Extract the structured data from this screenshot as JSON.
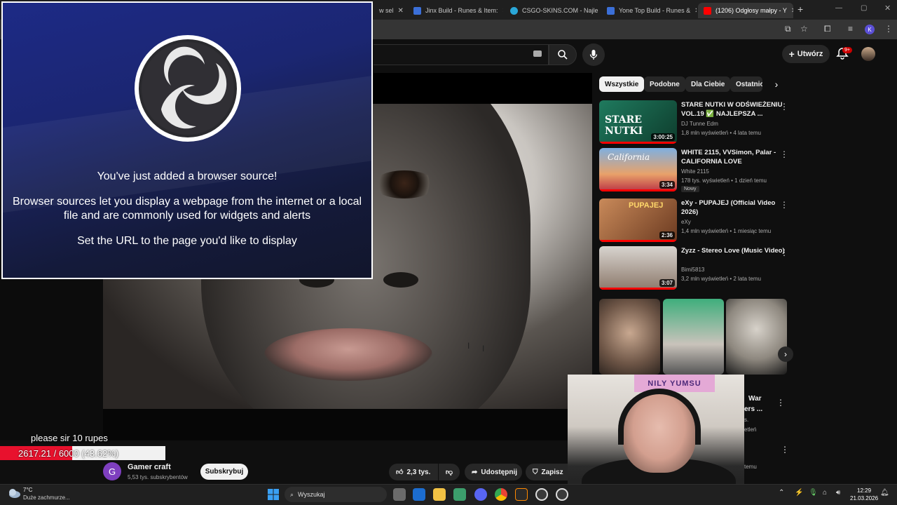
{
  "browser": {
    "tabs": [
      {
        "label": "w sel",
        "active": false
      },
      {
        "label": "Jinx Build - Runes & Item:",
        "active": false
      },
      {
        "label": "CSGO-SKINS.COM - Najle",
        "active": false
      },
      {
        "label": "Yone Top Build - Runes &",
        "active": false
      },
      {
        "label": "(1206) Odgłosy małpy - Y",
        "active": true
      }
    ],
    "profile_letter": "K"
  },
  "youtube": {
    "create_label": "Utwórz",
    "notif_count": "9+",
    "chips": [
      "Wszystkie",
      "Podobne",
      "Dla Ciebie",
      "Ostatnio"
    ],
    "recommendations": [
      {
        "title": "STARE NUTKI W ODŚWIEŻENIU VOL.19 ✅ NAJLEPSZA ...",
        "channel": "DJ Tunne Edm",
        "stats": "1,8 mln wyświetleń • 4 lata temu",
        "duration": "3:00:25",
        "badge": "",
        "thumb_text": "STARE NUTKI"
      },
      {
        "title": "WHITE 2115, VVSimon, Palar - CALIFORNIA LOVE",
        "channel": "White 2115",
        "stats": "178 tys. wyświetleń • 1 dzień temu",
        "duration": "3:34",
        "badge": "Nowy",
        "thumb_text": "California"
      },
      {
        "title": "eXy - PUPAJEJ (Official Video 2026)",
        "channel": "eXy",
        "stats": "1,4 mln wyświetleń • 1 miesiąc temu",
        "duration": "2:36",
        "badge": "",
        "thumb_text": "PUPAJEJ"
      },
      {
        "title": "Zyzz - Stereo Love (Music Video)",
        "channel": "Bimi5813",
        "stats": "3,2 mln wyświetleń • 2 lata temu",
        "duration": "3:07",
        "badge": "",
        "thumb_text": ""
      }
    ],
    "partial_items": {
      "title_fragment_1": "War",
      "title_fragment_2": "ers ...",
      "meta_1": "s.",
      "meta_2": "etleń",
      "meta_3": "temu"
    },
    "channel": {
      "name": "Gamer craft",
      "subs": "5,53 tys. subskrybentów",
      "avatar_letter": "G",
      "subscribe_label": "Subskrybuj"
    },
    "actions": {
      "likes": "2,3 tys.",
      "share": "Udostępnij",
      "save": "Zapisz"
    }
  },
  "obs_overlay": {
    "heading": "You've just added a browser source!",
    "body": "Browser sources let you display a webpage from the internet or a local file and are commonly used for widgets and alerts",
    "hint": "Set the URL to the page you'd like to display"
  },
  "donation": {
    "message": "please sir 10 rupes",
    "progress_label": "2617.21 / 6000 (43.62%)",
    "progress_fraction": 0.4362,
    "bar_color": "#e8112d"
  },
  "webcam": {
    "sign_text": "NILY YUMSU"
  },
  "taskbar": {
    "weather_temp": "7°C",
    "weather_desc": "Duże zachmurze...",
    "search_label": "Wyszukaj",
    "time": "12:29",
    "date": "21.03.2026"
  }
}
